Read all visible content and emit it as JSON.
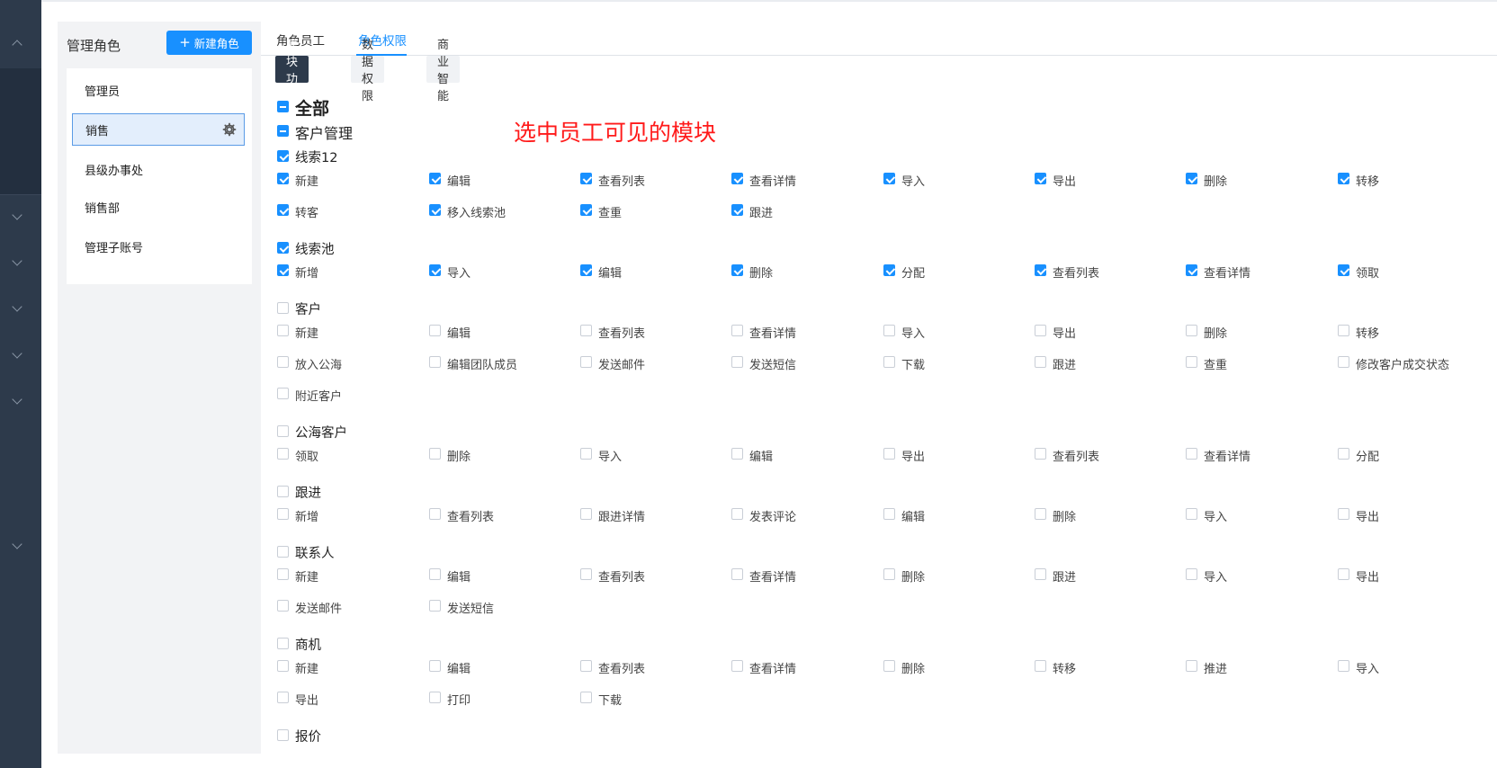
{
  "role_panel": {
    "title": "管理角色",
    "new_role_label": "新建角色",
    "roles": [
      "管理员",
      "销售",
      "县级办事处",
      "销售部",
      "管理子账号"
    ],
    "active_role": "销售"
  },
  "tabs": [
    "角色员工",
    "角色权限"
  ],
  "active_tab": "角色权限",
  "subtabs": [
    "模块功能",
    "数据权限",
    "商业智能"
  ],
  "active_subtab": "模块功能",
  "annotation": "选中员工可见的模块",
  "tree": {
    "all_label": "全部",
    "all_state": "indeterminate",
    "section_label": "客户管理",
    "section_state": "indeterminate",
    "groups": [
      {
        "label": "线索12",
        "checked": true,
        "items": [
          "新建",
          "编辑",
          "查看列表",
          "查看详情",
          "导入",
          "导出",
          "删除",
          "转移",
          "转客",
          "移入线索池",
          "查重",
          "跟进"
        ]
      },
      {
        "label": "线索池",
        "checked": true,
        "items": [
          "新增",
          "导入",
          "编辑",
          "删除",
          "分配",
          "查看列表",
          "查看详情",
          "领取"
        ]
      },
      {
        "label": "客户",
        "checked": false,
        "items": [
          "新建",
          "编辑",
          "查看列表",
          "查看详情",
          "导入",
          "导出",
          "删除",
          "转移",
          "放入公海",
          "编辑团队成员",
          "发送邮件",
          "发送短信",
          "下载",
          "跟进",
          "查重",
          "修改客户成交状态",
          "附近客户"
        ]
      },
      {
        "label": "公海客户",
        "checked": false,
        "items": [
          "领取",
          "删除",
          "导入",
          "编辑",
          "导出",
          "查看列表",
          "查看详情",
          "分配"
        ]
      },
      {
        "label": "跟进",
        "checked": false,
        "items": [
          "新增",
          "查看列表",
          "跟进详情",
          "发表评论",
          "编辑",
          "删除",
          "导入",
          "导出"
        ]
      },
      {
        "label": "联系人",
        "checked": false,
        "items": [
          "新建",
          "编辑",
          "查看列表",
          "查看详情",
          "删除",
          "跟进",
          "导入",
          "导出",
          "发送邮件",
          "发送短信"
        ]
      },
      {
        "label": "商机",
        "checked": false,
        "items": [
          "新建",
          "编辑",
          "查看列表",
          "查看详情",
          "删除",
          "转移",
          "推进",
          "导入",
          "导出",
          "打印",
          "下载"
        ]
      },
      {
        "label": "报价",
        "checked": false,
        "items": []
      }
    ]
  }
}
